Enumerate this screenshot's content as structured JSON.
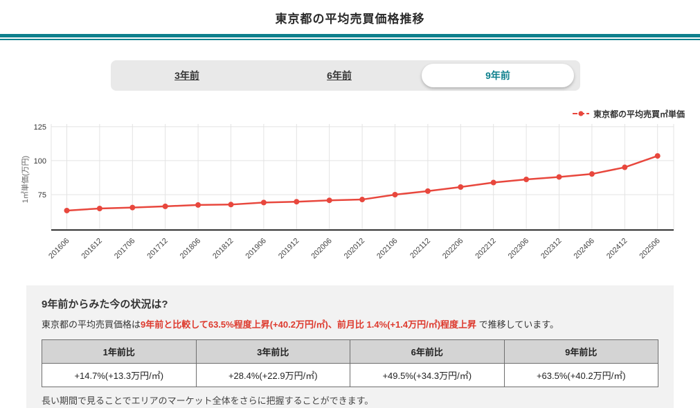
{
  "header": {
    "title": "東京都の平均売買価格推移"
  },
  "tabs": [
    {
      "label": "3年前",
      "active": false
    },
    {
      "label": "6年前",
      "active": false
    },
    {
      "label": "9年前",
      "active": true
    }
  ],
  "legend": {
    "label": "東京都の平均売買㎡単価"
  },
  "chart_data": {
    "type": "line",
    "ylabel": "1㎡単価(万円)",
    "categories": [
      "201606",
      "201612",
      "201706",
      "201712",
      "201806",
      "201812",
      "201906",
      "201912",
      "202006",
      "202012",
      "202106",
      "202112",
      "202206",
      "202212",
      "202306",
      "202312",
      "202406",
      "202412",
      "202506"
    ],
    "series": [
      {
        "name": "東京都の平均売買㎡単価",
        "values": [
          63.3,
          64.8,
          65.5,
          66.4,
          67.4,
          67.7,
          69.2,
          69.8,
          70.8,
          71.4,
          75.0,
          77.6,
          80.6,
          83.9,
          86.2,
          88.0,
          90.2,
          95.1,
          103.5
        ]
      }
    ],
    "yticks": [
      75,
      100,
      125
    ],
    "ylim": [
      49,
      128
    ],
    "grid": true,
    "xticks_rotation": -45,
    "legend_position": "top-right"
  },
  "summary": {
    "heading": "9年前からみた今の状況は?",
    "lead_plain": "東京都の平均売買価格は",
    "lead_highlight": "9年前と比較して63.5%程度上昇(+40.2万円/㎡)、前月比 1.4%(+1.4万円/㎡)程度上昇",
    "lead_tail": " で推移しています。",
    "table": {
      "headers": [
        "1年前比",
        "3年前比",
        "6年前比",
        "9年前比"
      ],
      "values": [
        "+14.7%(+13.3万円/㎡)",
        "+28.4%(+22.9万円/㎡)",
        "+49.5%(+34.3万円/㎡)",
        "+63.5%(+40.2万円/㎡)"
      ]
    },
    "note": "長い期間で見ることでエリアのマーケット全体をさらに把握することができます。"
  },
  "colors": {
    "accent_teal": "#0e808d",
    "line_red": "#e8473d",
    "text_red": "#dd392d",
    "grid_gray": "#e3e3e3",
    "axis_dark": "#333333"
  }
}
